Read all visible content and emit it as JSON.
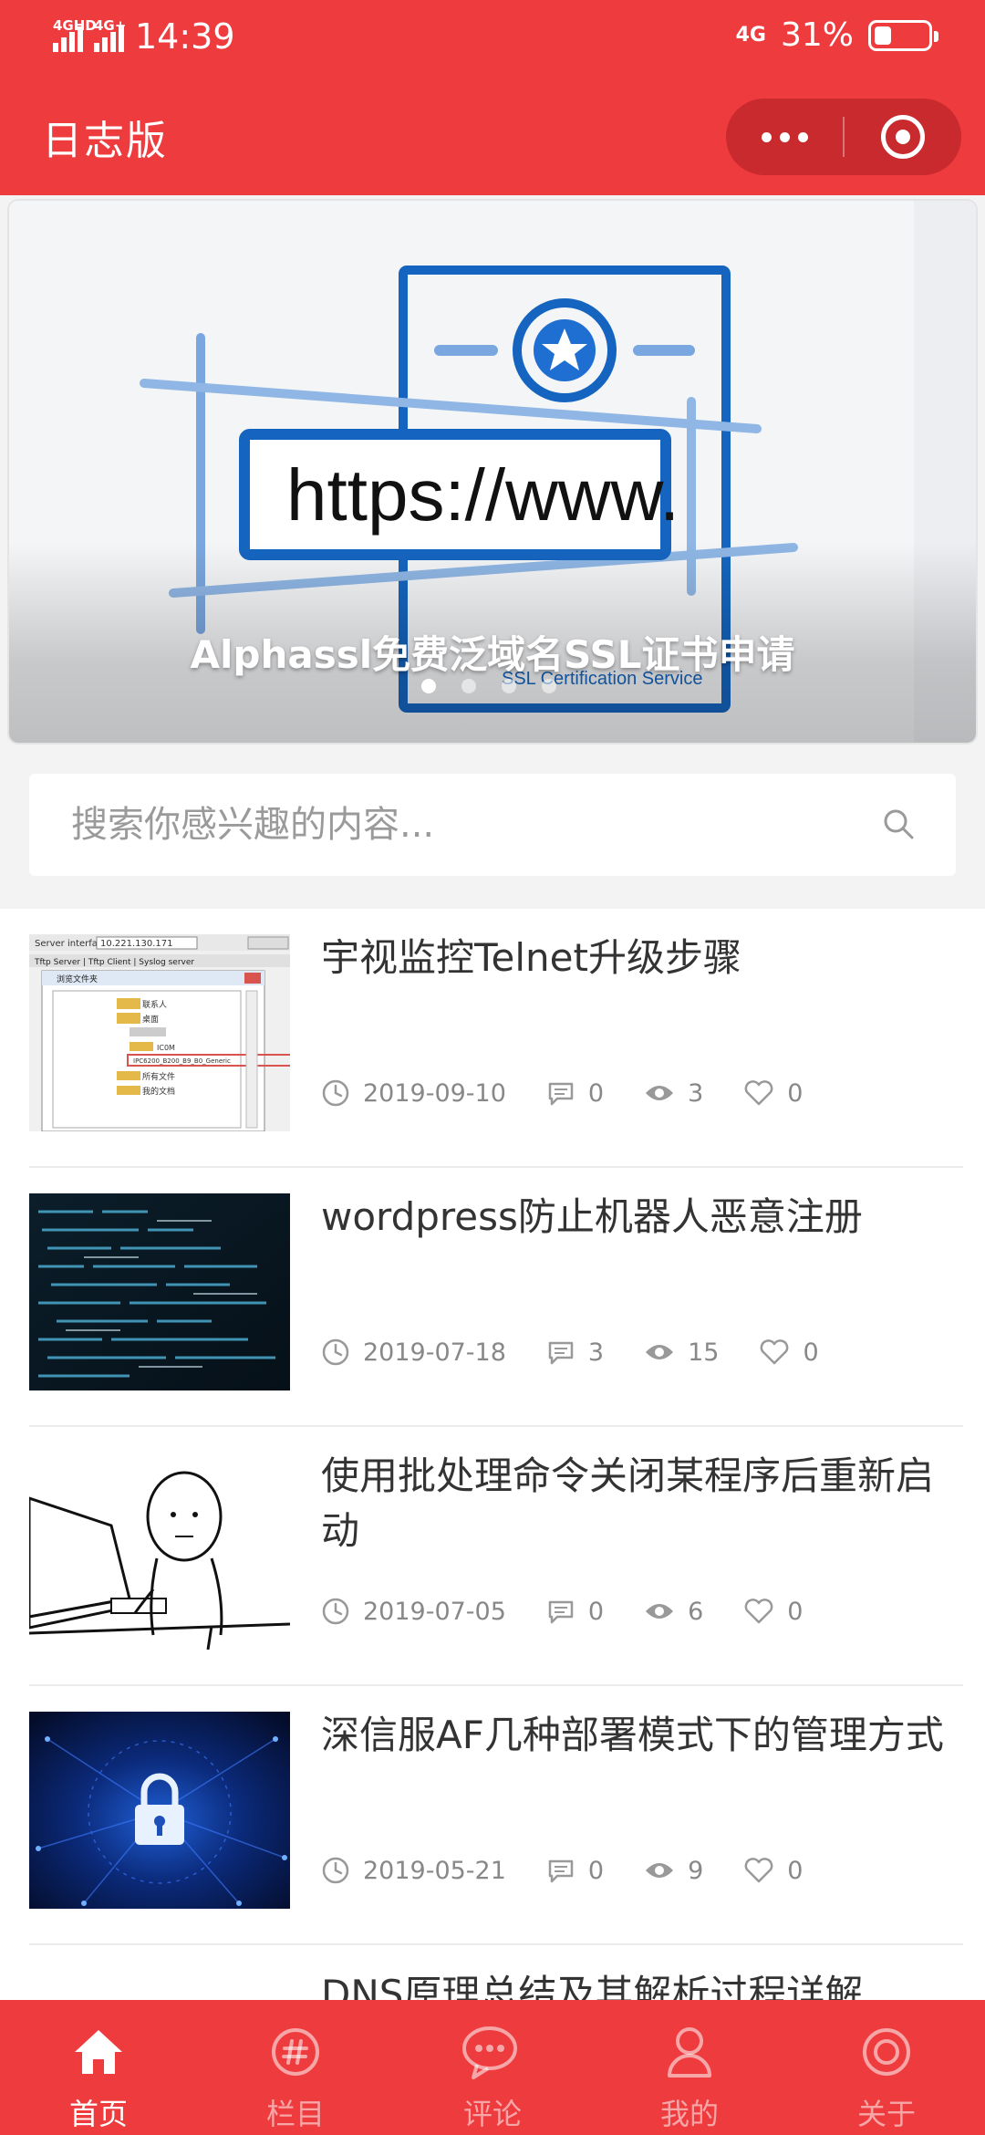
{
  "status_bar": {
    "signal_1": "4GHD",
    "signal_2": "4G+",
    "time": "14:39",
    "network": "4G",
    "battery": "31%",
    "battery_level": 0.31
  },
  "header": {
    "title": "日志版",
    "accent_color": "#ee3b3e"
  },
  "banner": {
    "image_text": "https://www.",
    "caption": "Alphassl免费泛域名SSL证书申请",
    "slide_count": 4,
    "active_slide": 1
  },
  "search": {
    "placeholder": "搜索你感兴趣的内容..."
  },
  "posts": [
    {
      "title": "宇视监控Telnet升级步骤",
      "date": "2019-09-10",
      "comments": "0",
      "views": "3",
      "likes": "0",
      "thumb": "file-dialog-screenshot"
    },
    {
      "title": "wordpress防止机器人恶意注册",
      "date": "2019-07-18",
      "comments": "3",
      "views": "15",
      "likes": "0",
      "thumb": "code-screen"
    },
    {
      "title": "使用批处理命令关闭某程序后重新启动",
      "date": "2019-07-05",
      "comments": "0",
      "views": "6",
      "likes": "0",
      "thumb": "comic-computer-user"
    },
    {
      "title": "深信服AF几种部署模式下的管理方式",
      "date": "2019-05-21",
      "comments": "0",
      "views": "9",
      "likes": "0",
      "thumb": "padlock-network"
    },
    {
      "title": "DNS原理总结及其解析过程详解",
      "date": "",
      "comments": "",
      "views": "",
      "likes": "",
      "thumb": ""
    }
  ],
  "tabs": [
    {
      "label": "首页",
      "icon": "home-icon",
      "active": true
    },
    {
      "label": "栏目",
      "icon": "hashtag-icon",
      "active": false
    },
    {
      "label": "评论",
      "icon": "chat-bubbles-icon",
      "active": false
    },
    {
      "label": "我的",
      "icon": "user-icon",
      "active": false
    },
    {
      "label": "关于",
      "icon": "about-target-icon",
      "active": false
    }
  ]
}
